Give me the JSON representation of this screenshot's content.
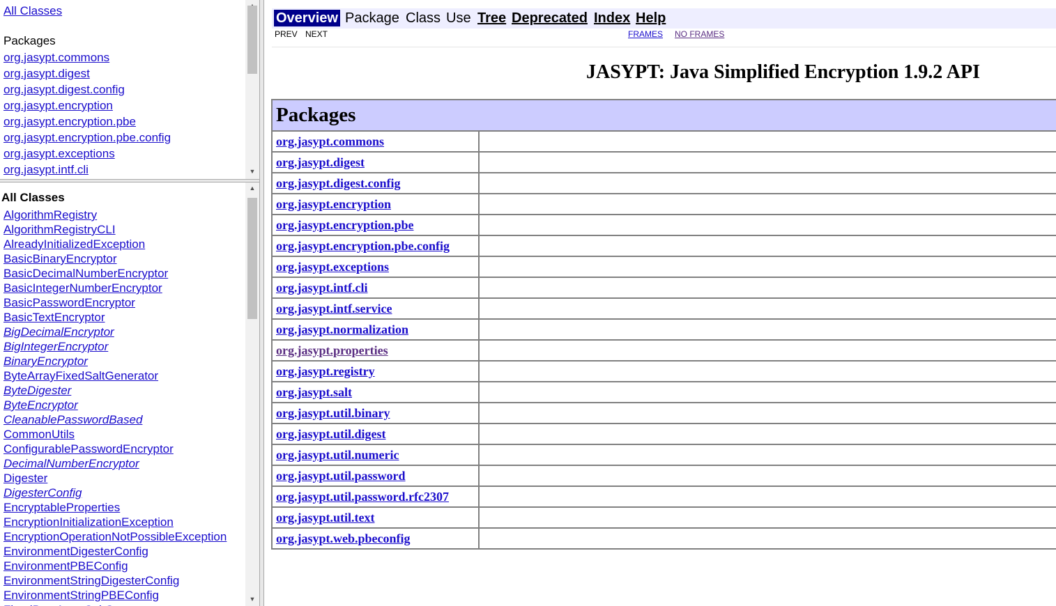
{
  "package_frame": {
    "all_classes_link": "All Classes",
    "heading": "Packages",
    "packages": [
      "org.jasypt.commons",
      "org.jasypt.digest",
      "org.jasypt.digest.config",
      "org.jasypt.encryption",
      "org.jasypt.encryption.pbe",
      "org.jasypt.encryption.pbe.config",
      "org.jasypt.exceptions",
      "org.jasypt.intf.cli"
    ]
  },
  "classes_frame": {
    "heading": "All Classes",
    "classes": [
      {
        "name": "AlgorithmRegistry",
        "italic": false
      },
      {
        "name": "AlgorithmRegistryCLI",
        "italic": false
      },
      {
        "name": "AlreadyInitializedException",
        "italic": false
      },
      {
        "name": "BasicBinaryEncryptor",
        "italic": false
      },
      {
        "name": "BasicDecimalNumberEncryptor",
        "italic": false
      },
      {
        "name": "BasicIntegerNumberEncryptor",
        "italic": false
      },
      {
        "name": "BasicPasswordEncryptor",
        "italic": false
      },
      {
        "name": "BasicTextEncryptor",
        "italic": false
      },
      {
        "name": "BigDecimalEncryptor",
        "italic": true
      },
      {
        "name": "BigIntegerEncryptor",
        "italic": true
      },
      {
        "name": "BinaryEncryptor",
        "italic": true
      },
      {
        "name": "ByteArrayFixedSaltGenerator",
        "italic": false
      },
      {
        "name": "ByteDigester",
        "italic": true
      },
      {
        "name": "ByteEncryptor",
        "italic": true
      },
      {
        "name": "CleanablePasswordBased",
        "italic": true
      },
      {
        "name": "CommonUtils",
        "italic": false
      },
      {
        "name": "ConfigurablePasswordEncryptor",
        "italic": false
      },
      {
        "name": "DecimalNumberEncryptor",
        "italic": true
      },
      {
        "name": "Digester",
        "italic": false
      },
      {
        "name": "DigesterConfig",
        "italic": true
      },
      {
        "name": "EncryptableProperties",
        "italic": false
      },
      {
        "name": "EncryptionInitializationException",
        "italic": false
      },
      {
        "name": "EncryptionOperationNotPossibleException",
        "italic": false
      },
      {
        "name": "EnvironmentDigesterConfig",
        "italic": false
      },
      {
        "name": "EnvironmentPBEConfig",
        "italic": false
      },
      {
        "name": "EnvironmentStringDigesterConfig",
        "italic": false
      },
      {
        "name": "EnvironmentStringPBEConfig",
        "italic": false
      },
      {
        "name": "FixedByteArraySaltGenerator",
        "italic": false
      }
    ]
  },
  "navbar": {
    "overview": "Overview",
    "package": "Package",
    "class": "Class",
    "use": "Use",
    "tree": "Tree",
    "deprecated": "Deprecated",
    "index": "Index",
    "help": "Help",
    "prev": "PREV",
    "next": "NEXT",
    "frames": "FRAMES",
    "no_frames": "NO FRAMES"
  },
  "title": "JASYPT: Java Simplified Encryption 1.9.2 API",
  "packages_table": {
    "heading": "Packages",
    "rows": [
      {
        "name": "org.jasypt.commons",
        "visited": false
      },
      {
        "name": "org.jasypt.digest",
        "visited": false
      },
      {
        "name": "org.jasypt.digest.config",
        "visited": false
      },
      {
        "name": "org.jasypt.encryption",
        "visited": false
      },
      {
        "name": "org.jasypt.encryption.pbe",
        "visited": false
      },
      {
        "name": "org.jasypt.encryption.pbe.config",
        "visited": false
      },
      {
        "name": "org.jasypt.exceptions",
        "visited": false
      },
      {
        "name": "org.jasypt.intf.cli",
        "visited": false
      },
      {
        "name": "org.jasypt.intf.service",
        "visited": false
      },
      {
        "name": "org.jasypt.normalization",
        "visited": false
      },
      {
        "name": "org.jasypt.properties",
        "visited": true
      },
      {
        "name": "org.jasypt.registry",
        "visited": false
      },
      {
        "name": "org.jasypt.salt",
        "visited": false
      },
      {
        "name": "org.jasypt.util.binary",
        "visited": false
      },
      {
        "name": "org.jasypt.util.digest",
        "visited": false
      },
      {
        "name": "org.jasypt.util.numeric",
        "visited": false
      },
      {
        "name": "org.jasypt.util.password",
        "visited": false
      },
      {
        "name": "org.jasypt.util.password.rfc2307",
        "visited": false
      },
      {
        "name": "org.jasypt.util.text",
        "visited": false
      },
      {
        "name": "org.jasypt.web.pbeconfig",
        "visited": false
      }
    ]
  },
  "icons": {
    "scroll_up": "triangle-up-icon",
    "scroll_down": "triangle-down-icon"
  }
}
